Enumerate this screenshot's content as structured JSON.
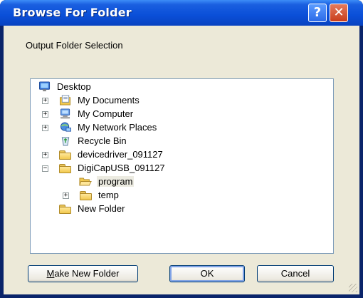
{
  "window": {
    "title": "Browse For Folder",
    "help_label": "?",
    "close_label": "✕"
  },
  "prompt": "Output Folder Selection",
  "tree": {
    "root": {
      "label": "Desktop",
      "icon": "desktop-icon"
    },
    "items": [
      {
        "label": "My Documents",
        "icon": "documents-icon",
        "expander": "+"
      },
      {
        "label": "My Computer",
        "icon": "computer-icon",
        "expander": "+"
      },
      {
        "label": "My Network Places",
        "icon": "network-icon",
        "expander": "+"
      },
      {
        "label": "Recycle Bin",
        "icon": "recycle-bin-icon",
        "expander": ""
      },
      {
        "label": "devicedriver_091127",
        "icon": "folder-icon",
        "expander": "+"
      },
      {
        "label": "DigiCapUSB_091127",
        "icon": "folder-icon",
        "expander": "−"
      },
      {
        "label": "program",
        "icon": "folder-open-icon",
        "expander": "",
        "selected": true
      },
      {
        "label": "temp",
        "icon": "folder-icon",
        "expander": "+"
      },
      {
        "label": "New Folder",
        "icon": "folder-icon",
        "expander": ""
      }
    ]
  },
  "buttons": {
    "make_new_folder": "Make New Folder",
    "ok": "OK",
    "cancel": "Cancel"
  }
}
